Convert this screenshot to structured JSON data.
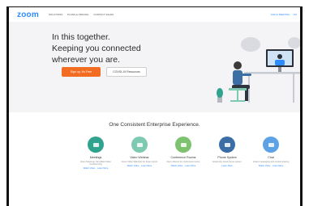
{
  "nav": {
    "logo": "zoom",
    "links": [
      "SOLUTIONS",
      "PLANS & PRICING",
      "CONTACT SALES"
    ],
    "right": [
      "JOIN A MEETING",
      "HO"
    ]
  },
  "hero": {
    "title_lines": [
      "In this together.",
      "Keeping you connected",
      "wherever you are."
    ],
    "primary_button": "Sign up, It's Free",
    "secondary_button": "COVID-19 Resources"
  },
  "section": {
    "title": "One Consistent Enterprise Experience."
  },
  "products": [
    {
      "name": "Meetings",
      "color": "#2fa38d",
      "desc": "Zoom Meetings: Simplified Video Conferencing",
      "links": [
        "Watch Video",
        "Learn More"
      ]
    },
    {
      "name": "Video Webinar",
      "color": "#7ec9b1",
      "desc": "Zoom Video Webinars for large events",
      "links": [
        "Watch Video",
        "Learn More"
      ]
    },
    {
      "name": "Conference Rooms",
      "color": "#7dc26e",
      "desc": "Zoom Rooms for conference rooms",
      "links": [
        "Watch Video",
        "Learn More"
      ]
    },
    {
      "name": "Phone System",
      "color": "#3a6ea5",
      "desc": "Enterprise cloud phone system",
      "links": [
        "Learn More"
      ]
    },
    {
      "name": "Chat",
      "color": "#5ea2e6",
      "desc": "Instant messaging and content sharing",
      "links": [
        "Watch Video",
        "Learn More"
      ]
    }
  ]
}
